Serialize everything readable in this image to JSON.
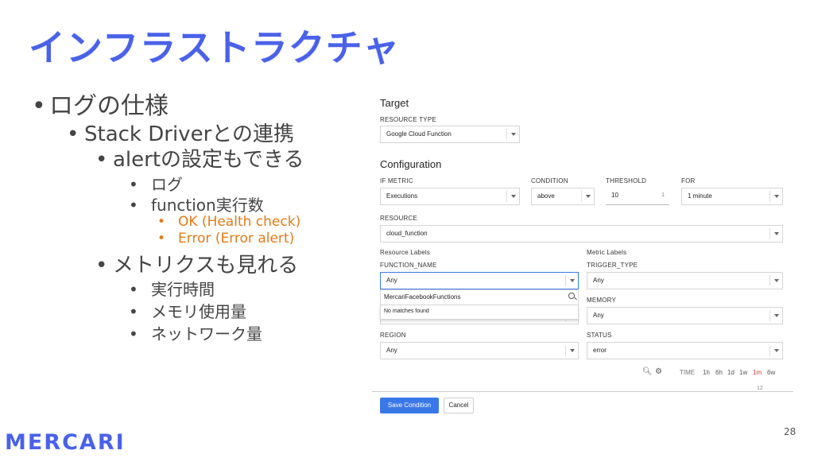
{
  "slide": {
    "title": "インフラストラクチャ",
    "bullets": [
      {
        "text": "ログの仕様",
        "level": 1
      },
      {
        "text": "Stack Driverとの連携",
        "level": 2
      },
      {
        "text": "alertの設定もできる",
        "level": 3
      },
      {
        "text": "ログ",
        "level": 4
      },
      {
        "text": "function実行数",
        "level": 4
      },
      {
        "text": "OK (Health check)",
        "level": 5
      },
      {
        "text": "Error (Error alert)",
        "level": 5
      },
      {
        "text": "メトリクスも見れる",
        "level": 3
      },
      {
        "text": "実行時間",
        "level": 4
      },
      {
        "text": "メモリ使用量",
        "level": 4
      },
      {
        "text": "ネットワーク量",
        "level": 4
      }
    ],
    "logo": "MERCARI",
    "page_number": "28",
    "accent_color": "#4a62e8",
    "highlight_color": "#e07b1a"
  },
  "form": {
    "target_title": "Target",
    "resource_type_label": "RESOURCE TYPE",
    "resource_type_value": "Google Cloud Function",
    "configuration_title": "Configuration",
    "if_metric_label": "IF METRIC",
    "if_metric_value": "Executions",
    "condition_label": "CONDITION",
    "condition_value": "above",
    "threshold_label": "THRESHOLD",
    "threshold_value": "10",
    "threshold_suffix": "1",
    "for_label": "FOR",
    "for_value": "1 minute",
    "resource_label": "RESOURCE",
    "resource_value": "cloud_function",
    "resource_labels_title": "Resource Labels",
    "function_name_label": "FUNCTION_NAME",
    "function_name_value": "Any",
    "search_value": "MercariFacebookFunctions",
    "no_matches": "No matches found",
    "region_label": "REGION",
    "region_value": "Any",
    "metric_labels_title": "Metric Labels",
    "trigger_type_label": "TRIGGER_TYPE",
    "trigger_type_value": "Any",
    "memory_label": "MEMORY",
    "memory_value": "Any",
    "status_label": "STATUS",
    "status_value": "error",
    "time_label": "TIME",
    "time_options": [
      "1h",
      "6h",
      "1d",
      "1w",
      "1m",
      "6w"
    ],
    "time_active": "1m",
    "chart_tick": "12",
    "save_label": "Save Condition",
    "cancel_label": "Cancel",
    "primary_color": "#3b78e7"
  }
}
